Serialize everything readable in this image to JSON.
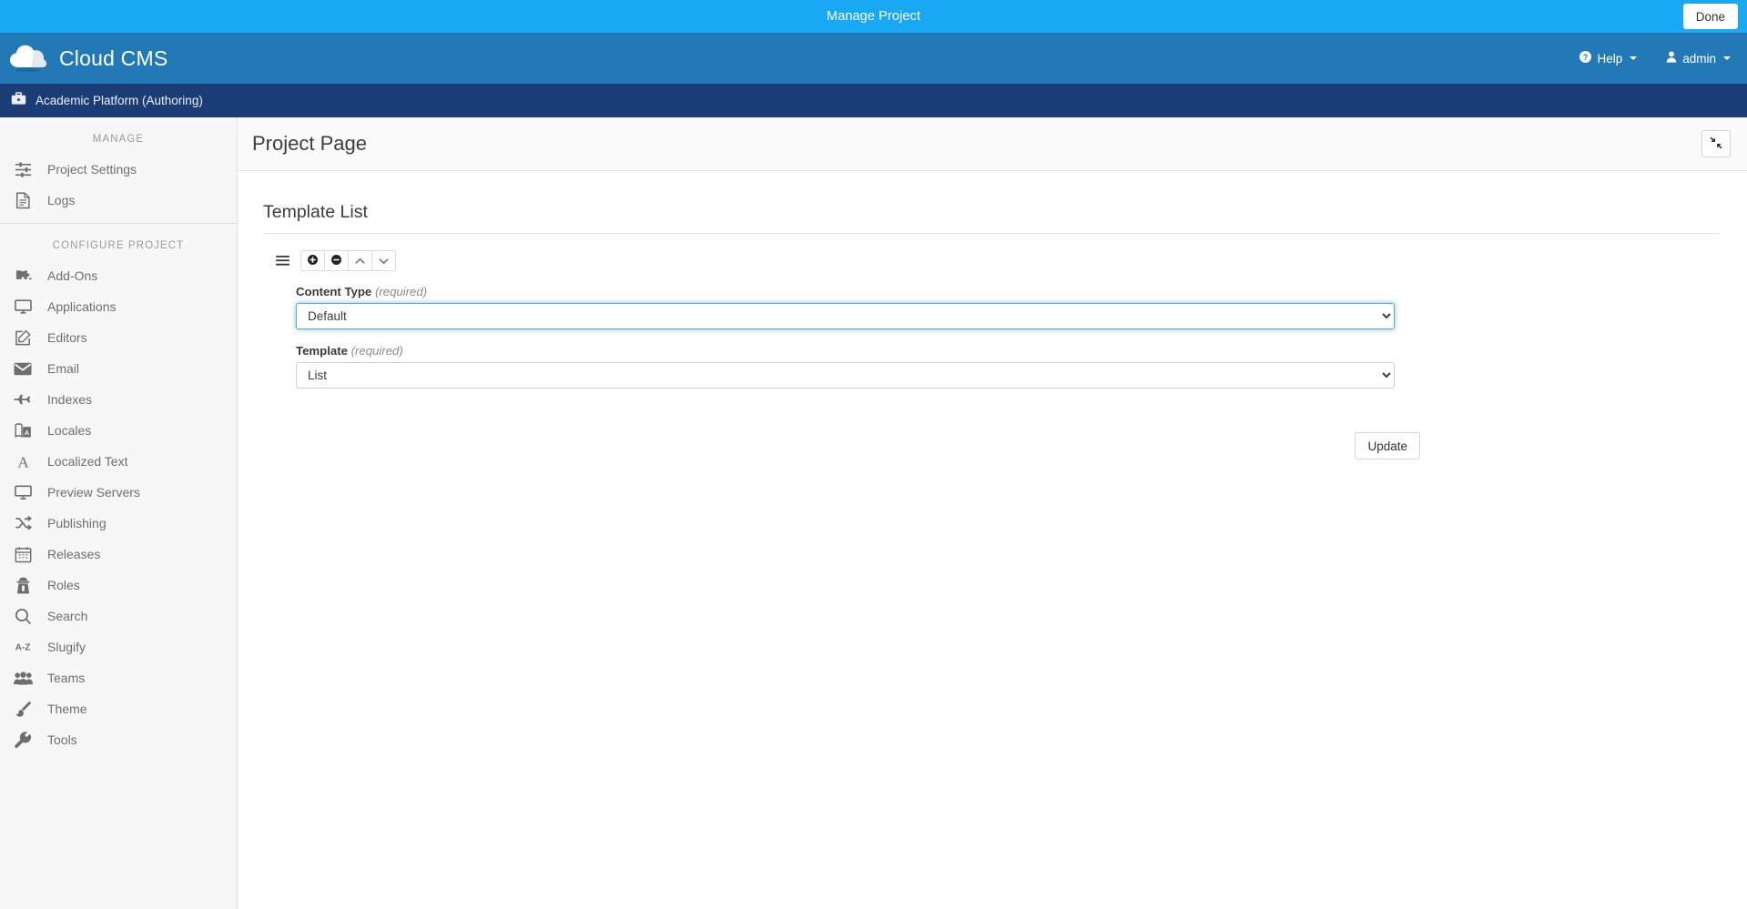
{
  "modal": {
    "title": "Manage Project",
    "done_label": "Done"
  },
  "brand": {
    "name": "Cloud CMS",
    "logo_icon": "cloud-icon",
    "help_label": "Help",
    "help_icon": "question-circle-icon",
    "user_label": "admin",
    "user_icon": "user-icon"
  },
  "project_bar": {
    "icon": "briefcase-icon",
    "label": "Academic Platform (Authoring)"
  },
  "sidebar": {
    "groups": [
      {
        "title": "MANAGE",
        "items": [
          {
            "label": "Project Settings",
            "icon": "sliders-icon"
          },
          {
            "label": "Logs",
            "icon": "document-icon"
          }
        ]
      },
      {
        "title": "CONFIGURE PROJECT",
        "items": [
          {
            "label": "Add-Ons",
            "icon": "puzzle-icon"
          },
          {
            "label": "Applications",
            "icon": "desktop-icon"
          },
          {
            "label": "Editors",
            "icon": "pencil-square-icon"
          },
          {
            "label": "Email",
            "icon": "envelope-icon"
          },
          {
            "label": "Indexes",
            "icon": "plane-icon"
          },
          {
            "label": "Locales",
            "icon": "language-icon"
          },
          {
            "label": "Localized Text",
            "icon": "font-icon"
          },
          {
            "label": "Preview Servers",
            "icon": "monitor-icon"
          },
          {
            "label": "Publishing",
            "icon": "shuffle-icon"
          },
          {
            "label": "Releases",
            "icon": "calendar-icon"
          },
          {
            "label": "Roles",
            "icon": "user-secret-icon"
          },
          {
            "label": "Search",
            "icon": "search-icon"
          },
          {
            "label": "Slugify",
            "icon": "a-z-icon"
          },
          {
            "label": "Teams",
            "icon": "users-icon"
          },
          {
            "label": "Theme",
            "icon": "paintbrush-icon"
          },
          {
            "label": "Tools",
            "icon": "wrench-icon"
          }
        ]
      }
    ]
  },
  "page": {
    "title": "Project Page",
    "collapse_icon": "compress-icon"
  },
  "panel": {
    "title": "Template List",
    "toolbar": {
      "drag_icon": "drag-handle-icon",
      "buttons": [
        {
          "icon": "plus-circle-icon",
          "name": "add-item-button"
        },
        {
          "icon": "minus-circle-icon",
          "name": "remove-item-button"
        },
        {
          "icon": "chevron-up-icon",
          "name": "move-up-button"
        },
        {
          "icon": "chevron-down-icon",
          "name": "move-down-button"
        }
      ]
    },
    "fields": [
      {
        "label": "Content Type",
        "required_note": "(required)",
        "value": "Default",
        "focused": true,
        "options": [
          "Default"
        ]
      },
      {
        "label": "Template",
        "required_note": "(required)",
        "value": "List",
        "focused": false,
        "options": [
          "List"
        ]
      }
    ],
    "update_label": "Update"
  },
  "colors": {
    "modal_bar": "#18a8f4",
    "brand_bar": "#2279b5",
    "project_bar": "#1b3d76",
    "sidebar_bg": "#f7f7f7",
    "focus_blue": "#5aa9e6"
  }
}
